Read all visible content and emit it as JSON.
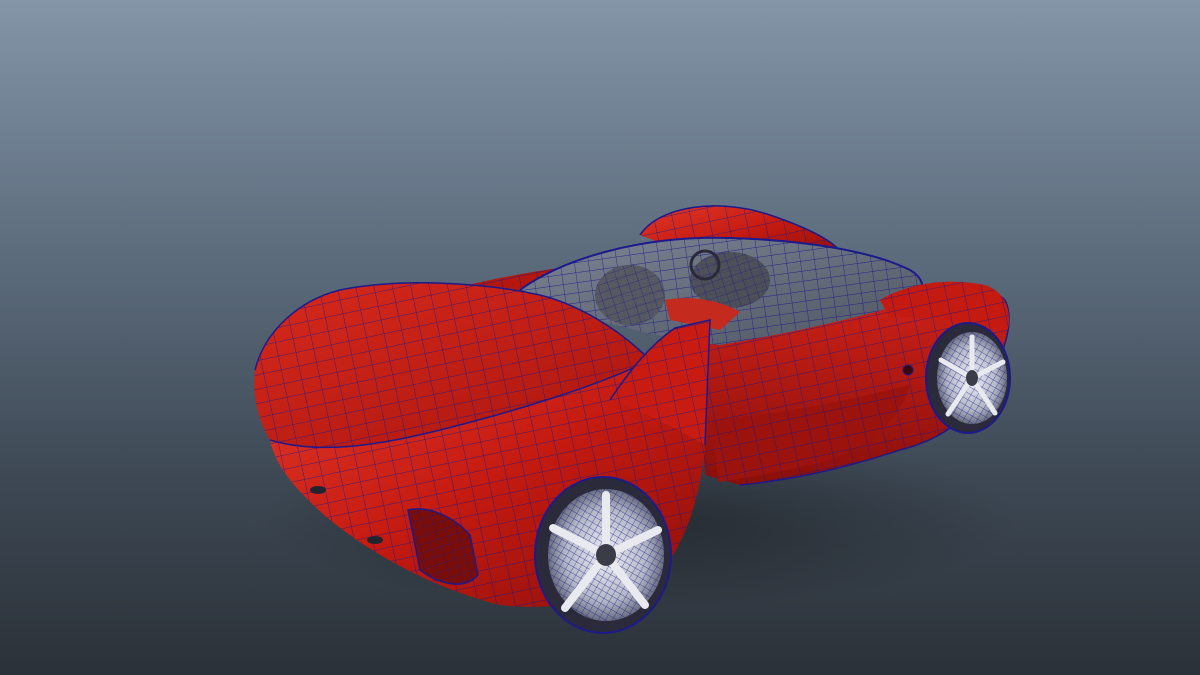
{
  "viewport": {
    "background_top": "#8495a8",
    "background_bottom": "#2b3138"
  },
  "model": {
    "object": "sports-car-concept",
    "display_mode": "smooth-shaded-with-wireframe-on-shaded",
    "body_color": "#c41a10",
    "body_highlight": "#e8402c",
    "body_shadow": "#7a0d08",
    "wireframe_color": "#1c1a8c",
    "glass_color": "#6a7180",
    "wheel_rim_color": "#c9ccd6",
    "tire_color": "#2a2a3a",
    "interior_color": "#55565c"
  }
}
